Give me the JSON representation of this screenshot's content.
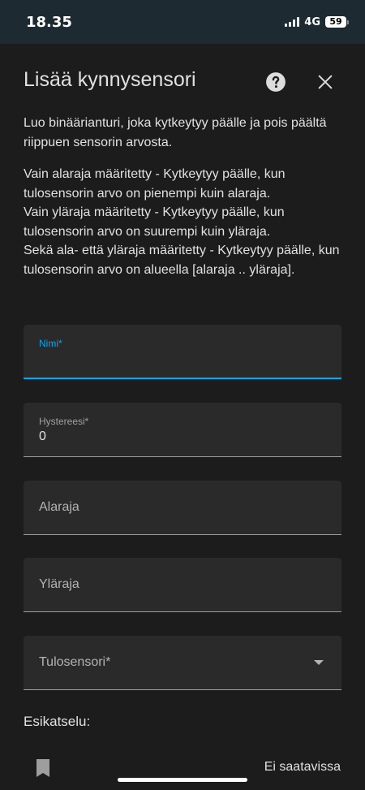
{
  "status_bar": {
    "time": "18.35",
    "network": "4G",
    "battery": "59"
  },
  "dialog": {
    "title": "Lisää kynnysensori",
    "description_1": "Luo binäärianturi, joka kytkeytyy päälle ja pois päältä riippuen sensorin arvosta.",
    "description_2_lines": [
      "Vain alaraja määritetty - Kytkeytyy päälle, kun tulosensorin arvo on pienempi kuin alaraja.",
      "Vain yläraja määritetty - Kytkeytyy päälle, kun tulosensorin arvo on suurempi kuin yläraja.",
      "Sekä ala- että yläraja määritetty - Kytkeytyy päälle, kun tulosensorin arvo on alueella [alaraja .. yläraja]."
    ],
    "fields": {
      "name": {
        "label": "Nimi*",
        "value": ""
      },
      "hysteresis": {
        "label": "Hystereesi*",
        "value": "0"
      },
      "lower": {
        "label": "Alaraja",
        "value": ""
      },
      "upper": {
        "label": "Yläraja",
        "value": ""
      },
      "input_sensor": {
        "label": "Tulosensori*",
        "value": ""
      }
    },
    "preview": {
      "label": "Esikatselu:",
      "state": "Ei saatavissa"
    }
  },
  "colors": {
    "accent": "#03a9f4",
    "background": "#1c1c1c",
    "field_background": "#2a2a2a",
    "status_bar": "#1d2a31"
  },
  "icons": {
    "help": "help-circle-icon",
    "close": "close-icon",
    "dropdown": "chevron-down-icon",
    "preview": "bookmark-icon"
  }
}
